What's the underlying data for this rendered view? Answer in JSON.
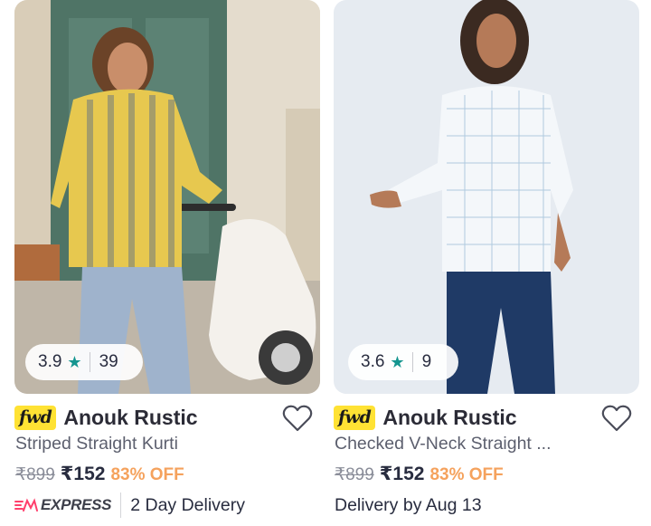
{
  "products": [
    {
      "rating": "3.9",
      "rating_count": "39",
      "badge": "fwd",
      "brand": "Anouk Rustic",
      "title": "Striped Straight Kurti",
      "mrp": "₹899",
      "price": "₹152",
      "discount": "83% OFF",
      "express_label": "EXPRESS",
      "delivery": "2 Day Delivery"
    },
    {
      "rating": "3.6",
      "rating_count": "9",
      "badge": "fwd",
      "brand": "Anouk Rustic",
      "title": "Checked V-Neck Straight ...",
      "mrp": "₹899",
      "price": "₹152",
      "discount": "83% OFF",
      "delivery": "Delivery by Aug 13"
    }
  ],
  "colors": {
    "badge_yellow": "#ffe234",
    "rating_star": "#14958f",
    "discount": "#f5a25d",
    "express_red": "#ff3f6c"
  },
  "icons": [
    "star-icon",
    "heart-icon",
    "express-icon"
  ]
}
